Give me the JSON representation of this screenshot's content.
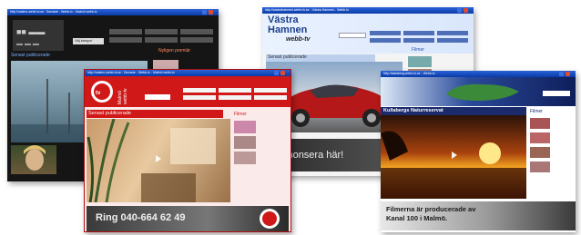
{
  "windows": {
    "w1": {
      "title": "http://malmo.webb-tv.se - Senaste - Webb-tv - Malmö webb-tv",
      "section_label": "Senast publicerade",
      "side_label": "Nyligen premiär",
      "dropdown_label": "Välj kategori"
    },
    "w2": {
      "title": "http://malmo.webb-tv.se - Senaste - Webb-tv - Malmö webb-tv",
      "logo_text": "Malmö webb-tv",
      "section_label": "Senast publicerade",
      "side_label": "Filmer",
      "ad_text": "Ring 040-664 62 49"
    },
    "w3": {
      "title": "http://vastrahamnen.webb-tv.se - Västra Hamnen - Webb-tv",
      "logo_line1": "Västra",
      "logo_line2": "Hamnen",
      "logo_sub": "webb-tv",
      "section_label": "Senast publicerade",
      "side_label": "Filmer",
      "ad_text": "Annonsera här!"
    },
    "w4": {
      "title": "http://kallaberg.webb-tv.se - Webb-tv",
      "section_label": "Kullabergs Naturreservat",
      "side_label": "Filmer",
      "ad_text_line1": "Filmerna är producerade av",
      "ad_text_line2": "Kanal 100 i Malmö."
    }
  },
  "colors": {
    "titlebar": "#0a3ca8",
    "w2_accent": "#d01818",
    "w3_accent": "#2a55a8",
    "w4_accent": "#1a2a6a"
  }
}
